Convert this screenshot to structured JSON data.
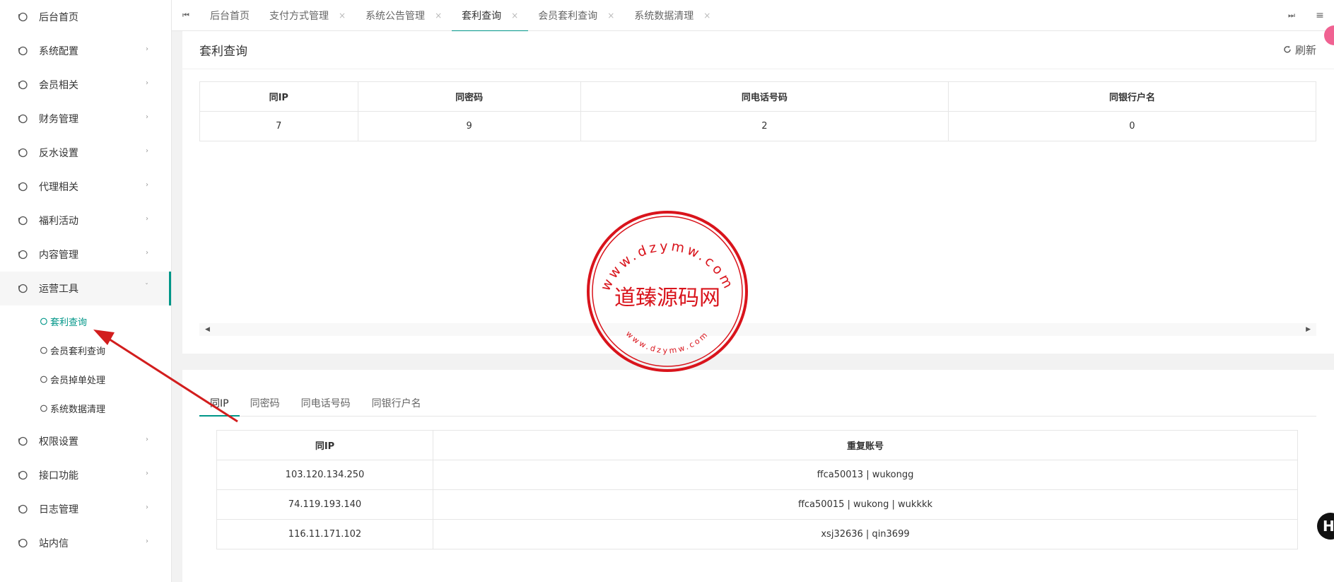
{
  "sidebar": {
    "items": [
      {
        "label": "后台首页"
      },
      {
        "label": "系统配置"
      },
      {
        "label": "会员相关"
      },
      {
        "label": "财务管理"
      },
      {
        "label": "反水设置"
      },
      {
        "label": "代理相关"
      },
      {
        "label": "福利活动"
      },
      {
        "label": "内容管理"
      },
      {
        "label": "运营工具"
      }
    ],
    "sub_items": [
      {
        "label": "套利查询"
      },
      {
        "label": "会员套利查询"
      },
      {
        "label": "会员掉单处理"
      },
      {
        "label": "系统数据清理"
      }
    ],
    "items_after": [
      {
        "label": "权限设置"
      },
      {
        "label": "接口功能"
      },
      {
        "label": "日志管理"
      },
      {
        "label": "站内信"
      }
    ]
  },
  "tabs": [
    {
      "label": "后台首页"
    },
    {
      "label": "支付方式管理"
    },
    {
      "label": "系统公告管理"
    },
    {
      "label": "套利查询"
    },
    {
      "label": "会员套利查询"
    },
    {
      "label": "系统数据清理"
    }
  ],
  "card": {
    "title": "套利查询",
    "refresh_label": "刷新"
  },
  "summary": {
    "headers": [
      "同IP",
      "同密码",
      "同电话号码",
      "同银行户名"
    ],
    "values": [
      "7",
      "9",
      "2",
      "0"
    ]
  },
  "detail_tabs": [
    "同IP",
    "同密码",
    "同电话号码",
    "同银行户名"
  ],
  "detail": {
    "headers": [
      "同IP",
      "重复账号"
    ],
    "rows": [
      [
        "103.120.134.250",
        "ffca50013 | wukongg"
      ],
      [
        "74.119.193.140",
        "ffca50015 | wukong | wukkkk"
      ],
      [
        "116.11.171.102",
        "xsj32636 | qin3699"
      ]
    ]
  },
  "seal": {
    "center_text": "道臻源码网",
    "ring_text": "www.dzymw.com"
  },
  "colors": {
    "accent": "#009688",
    "seal_red": "#d9141c",
    "annotation_arrow": "#d21d1d"
  }
}
